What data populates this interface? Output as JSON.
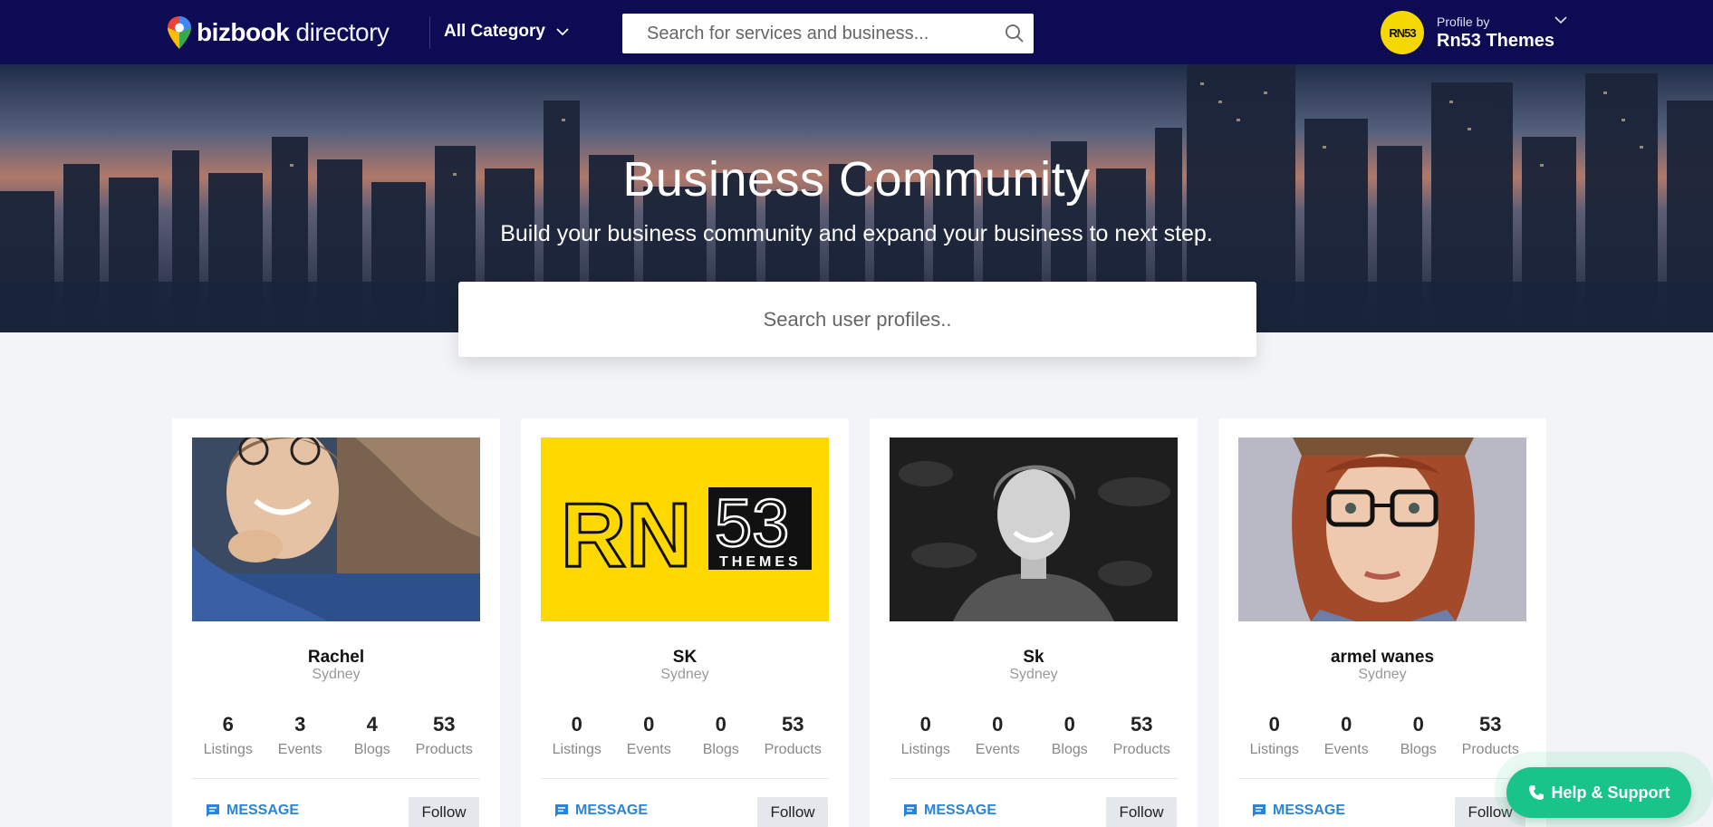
{
  "header": {
    "brand_bold": "bizbook",
    "brand_light": " directory",
    "category_label": "All Category",
    "search_placeholder": "Search for services and business...",
    "profile_by": "Profile by",
    "profile_name": "Rn53 Themes",
    "avatar_text": "RN53"
  },
  "hero": {
    "title": "Business Community",
    "subtitle": "Build your business community and expand your business to next step.",
    "search_placeholder": "Search user profiles.."
  },
  "cards": [
    {
      "name": "Rachel",
      "city": "Sydney",
      "stats": [
        {
          "value": "6",
          "label": "Listings"
        },
        {
          "value": "3",
          "label": "Events"
        },
        {
          "value": "4",
          "label": "Blogs"
        },
        {
          "value": "53",
          "label": "Products"
        }
      ],
      "message_label": "MESSAGE",
      "follow_label": "Follow"
    },
    {
      "name": "SK",
      "city": "Sydney",
      "logo_text_main": "RN",
      "logo_text_num": "53",
      "logo_text_sub": "THEMES",
      "stats": [
        {
          "value": "0",
          "label": "Listings"
        },
        {
          "value": "0",
          "label": "Events"
        },
        {
          "value": "0",
          "label": "Blogs"
        },
        {
          "value": "53",
          "label": "Products"
        }
      ],
      "message_label": "MESSAGE",
      "follow_label": "Follow"
    },
    {
      "name": "Sk",
      "city": "Sydney",
      "stats": [
        {
          "value": "0",
          "label": "Listings"
        },
        {
          "value": "0",
          "label": "Events"
        },
        {
          "value": "0",
          "label": "Blogs"
        },
        {
          "value": "53",
          "label": "Products"
        }
      ],
      "message_label": "MESSAGE",
      "follow_label": "Follow"
    },
    {
      "name": "armel wanes",
      "city": "Sydney",
      "stats": [
        {
          "value": "0",
          "label": "Listings"
        },
        {
          "value": "0",
          "label": "Events"
        },
        {
          "value": "0",
          "label": "Blogs"
        },
        {
          "value": "53",
          "label": "Products"
        }
      ],
      "message_label": "MESSAGE",
      "follow_label": "Follow"
    }
  ],
  "help": {
    "label": "Help & Support"
  },
  "colors": {
    "header_bg": "#0d0b54",
    "accent_blue": "#2c84d6",
    "help_green": "#19c48a",
    "rn53_yellow": "#ffd800"
  },
  "icons": [
    "map-pin-logo-icon",
    "chevron-down-icon",
    "search-icon",
    "message-icon",
    "phone-icon"
  ]
}
